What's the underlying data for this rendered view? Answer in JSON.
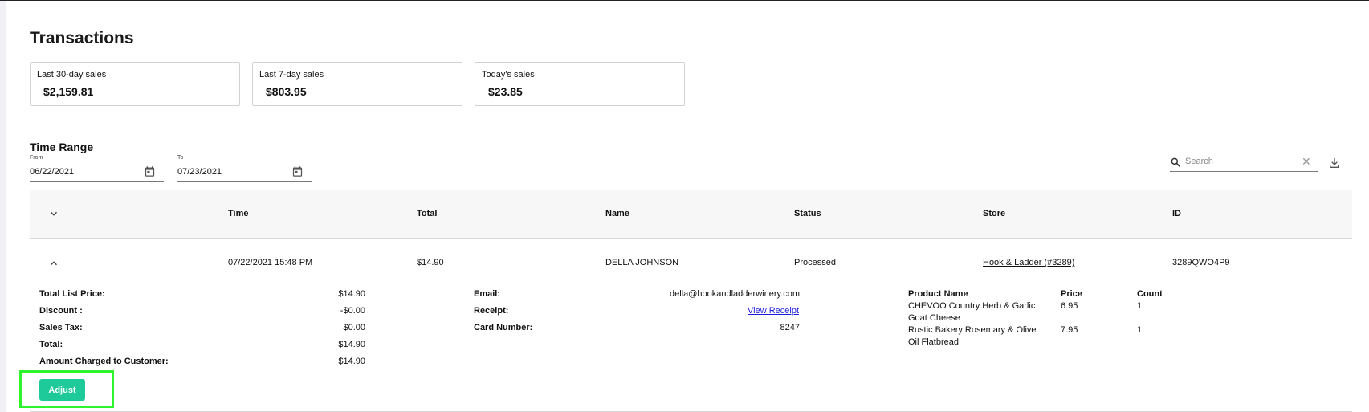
{
  "page": {
    "title": "Transactions"
  },
  "summary_cards": [
    {
      "label": "Last 30-day sales",
      "value": "$2,159.81"
    },
    {
      "label": "Last 7-day sales",
      "value": "$803.95"
    },
    {
      "label": "Today's sales",
      "value": "$23.85"
    }
  ],
  "time_range": {
    "title": "Time Range",
    "from_label": "From",
    "from_value": "06/22/2021",
    "to_label": "To",
    "to_value": "07/23/2021"
  },
  "search": {
    "placeholder": "Search",
    "clear_glyph": "✕"
  },
  "icons": {
    "calendar": "calendar-icon",
    "search": "search-icon",
    "download": "download-icon",
    "chevron_down": "chevron-down-icon",
    "chevron_up": "chevron-up-icon",
    "close": "close-icon"
  },
  "table": {
    "columns": [
      "Time",
      "Total",
      "Name",
      "Status",
      "Store",
      "ID"
    ],
    "rows": [
      {
        "time": "07/22/2021 15:48 PM",
        "total": "$14.90",
        "name": "DELLA JOHNSON",
        "status": "Processed",
        "store": "Hook & Ladder (#3289)",
        "id": "3289QWO4P9"
      }
    ]
  },
  "details": {
    "pricing": [
      {
        "label": "Total List Price:",
        "value": "$14.90"
      },
      {
        "label": "Discount :",
        "value": "-$0.00"
      },
      {
        "label": "Sales Tax:",
        "value": "$0.00"
      },
      {
        "label": "Total:",
        "value": "$14.90"
      },
      {
        "label": "Amount Charged to Customer:",
        "value": "$14.90"
      }
    ],
    "customer": {
      "email_label": "Email:",
      "email": "della@hookandladderwinery.com",
      "receipt_label": "Receipt:",
      "receipt_link": "View Receipt",
      "card_label": "Card Number:",
      "card_number": "8247"
    },
    "products": {
      "headers": {
        "name": "Product Name",
        "price": "Price",
        "count": "Count"
      },
      "items": [
        {
          "name_line1": "CHEVOO Country Herb & Garlic",
          "name_line2": "Goat Cheese",
          "price": "6.95",
          "count": "1"
        },
        {
          "name_line1": "Rustic Bakery Rosemary & Olive",
          "name_line2": "Oil Flatbread",
          "price": "7.95",
          "count": "1"
        }
      ]
    },
    "adjust_label": "Adjust"
  },
  "colors": {
    "accent": "#1ec99a",
    "link": "#1a1adc",
    "highlight": "#2ef52b",
    "header_bg": "#f7f7f7"
  }
}
